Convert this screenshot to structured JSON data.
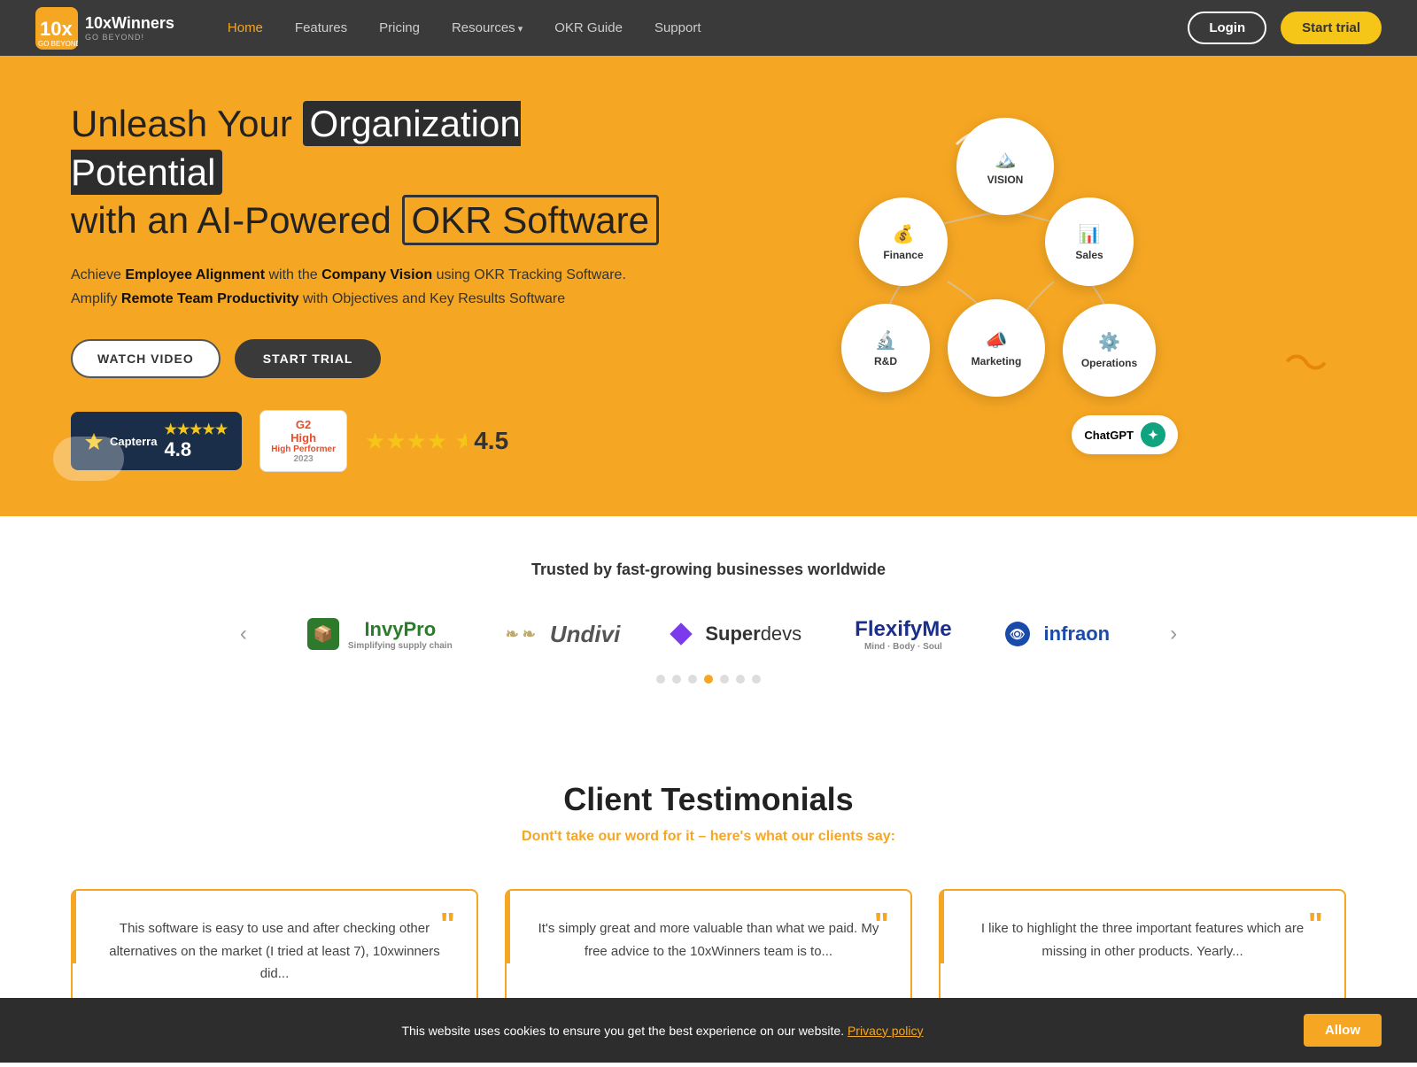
{
  "brand": {
    "name": "10xWinners",
    "tagline": "GO BEYOND!",
    "logo_symbol": "⟨✕⟩"
  },
  "navbar": {
    "links": [
      {
        "label": "Home",
        "active": true
      },
      {
        "label": "Features",
        "active": false
      },
      {
        "label": "Pricing",
        "active": false
      },
      {
        "label": "Resources",
        "active": false,
        "has_arrow": true
      },
      {
        "label": "OKR Guide",
        "active": false
      },
      {
        "label": "Support",
        "active": false
      }
    ],
    "login_label": "Login",
    "start_trial_label": "Start trial"
  },
  "hero": {
    "title_part1": "Unleash Your",
    "title_highlight1": "Organization Potential",
    "title_part2": "with an AI-Powered",
    "title_highlight2": "OKR Software",
    "description": "Achieve Employee Alignment with the Company Vision using OKR Tracking Software. Amplify Remote Team Productivity with Objectives and Key Results Software",
    "btn_watch": "WATCH VIDEO",
    "btn_trial": "START TRIAL",
    "capterra_rating": "4.8",
    "capterra_stars": "★★★★★",
    "g2_label": "High Performer",
    "g2_year": "2023",
    "review_stars": "★★★★½",
    "review_score": "4.5"
  },
  "diagram": {
    "circles": [
      {
        "label": "VISION",
        "icon": "🏔️",
        "class": "circle-vision"
      },
      {
        "label": "Finance",
        "icon": "💰",
        "class": "circle-finance"
      },
      {
        "label": "Sales",
        "icon": "📊",
        "class": "circle-sales"
      },
      {
        "label": "R&D",
        "icon": "🔬",
        "class": "circle-rd"
      },
      {
        "label": "Marketing",
        "icon": "📣",
        "class": "circle-marketing"
      },
      {
        "label": "Operations",
        "icon": "⚙️",
        "class": "circle-operations"
      }
    ],
    "chatgpt_label": "ChatGPT"
  },
  "trusted": {
    "title": "Trusted by fast-growing businesses worldwide",
    "logos": [
      {
        "name": "InvyPro",
        "tagline": "Simplifying supply chain"
      },
      {
        "name": "Undivi"
      },
      {
        "name": "Superdevs"
      },
      {
        "name": "FlexifyMe",
        "tagline": "Mind · Body · Soul"
      },
      {
        "name": "infraon"
      }
    ],
    "dots": [
      false,
      false,
      false,
      true,
      false,
      false,
      false
    ]
  },
  "testimonials": {
    "title": "Client Testimonials",
    "subtitle": "Dont't take our word for it – here's what our clients say:",
    "cards": [
      {
        "text": "This software is easy to use and after checking other alternatives on the market (I tried at least 7), 10xwinners did..."
      },
      {
        "text": "It's simply great and more valuable than what we paid. My free advice to the 10xWinners team is to..."
      },
      {
        "text": "I like to highlight the three important features which are missing in other products. Yearly..."
      }
    ]
  },
  "cookie": {
    "message": "This website uses cookies to ensure you get the best experience on our website.",
    "link_text": "Privacy policy",
    "allow_label": "Allow"
  },
  "colors": {
    "primary": "#f5a623",
    "dark": "#3a3a3a",
    "accent": "#f5c518"
  }
}
